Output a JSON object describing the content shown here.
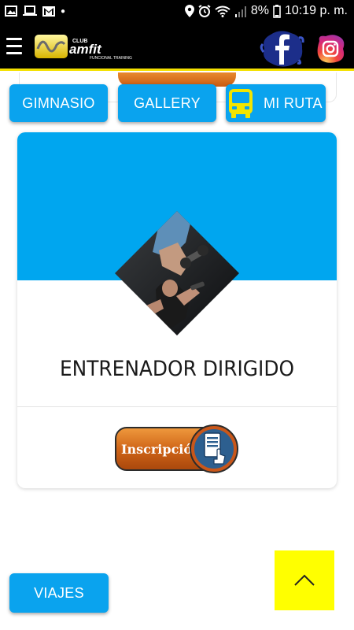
{
  "status_bar": {
    "time": "10:19 p. m.",
    "battery": "8%"
  },
  "header": {
    "logo_club": "CLUB",
    "logo_name": "amfit",
    "logo_tagline": "FUNCIONAL TRAINING",
    "icons": [
      "menu-icon",
      "facebook-icon",
      "instagram-icon"
    ]
  },
  "nav": {
    "gimnasio": "GIMNASIO",
    "gallery": "GALLERY",
    "mi_ruta": "MI RUTA"
  },
  "card": {
    "title": "ENTRENADOR DIRIGIDO",
    "button_label": "Inscripción"
  },
  "bottom": {
    "viajes": "VIAJES"
  },
  "colors": {
    "primary": "#0aa3ee",
    "banner": "#00a6ef",
    "header_bg": "#000000",
    "header_border": "#f4e000",
    "scroll_top_bg": "#ffff00",
    "button_orange": "#d36a1c"
  }
}
